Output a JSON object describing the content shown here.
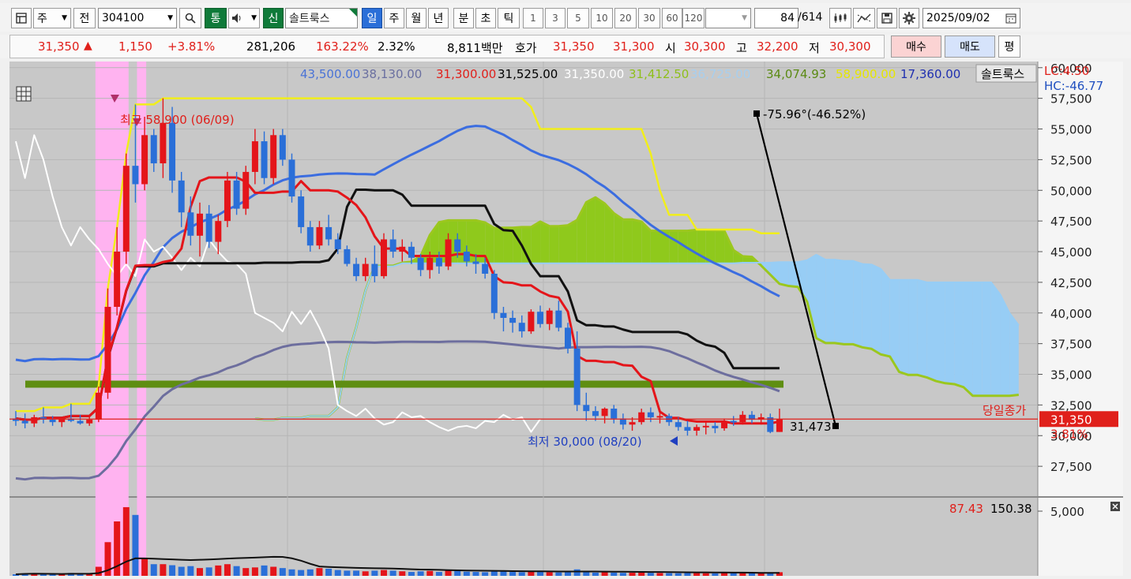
{
  "toolbar": {
    "mode": "주",
    "jeon": "전",
    "code": "304100",
    "tong": "통",
    "sin": "신",
    "stock_name": "솔트룩스",
    "periods": [
      "일",
      "주",
      "월",
      "년",
      "분",
      "초",
      "틱"
    ],
    "intervals": [
      "1",
      "3",
      "5",
      "10",
      "20",
      "30",
      "60",
      "120"
    ],
    "count": "84",
    "count_total": "/614",
    "date": "2025/09/02"
  },
  "quote": {
    "price": "31,350",
    "change": "1,150",
    "pct": "+3.81%",
    "volume": "281,206",
    "vol_ratio": "163.22%",
    "turnover": "2.32%",
    "amount": "8,811백만",
    "hoga_label": "호가",
    "ask": "31,350",
    "bid": "31,300",
    "open_label": "시",
    "open": "30,300",
    "high_label": "고",
    "high": "32,200",
    "low_label": "저",
    "low": "30,300",
    "buy": "매수",
    "sell": "매도",
    "eval": "평"
  },
  "legend": {
    "v1": "43,500.00",
    "v2": "38,130.00",
    "v3": "31,300.00",
    "v4": "31,525.00",
    "v5": "31,350.00",
    "v6": "31,412.50",
    "v7": "36,725.00",
    "v8": "34,074.93",
    "v9": "58,900.00",
    "v10": "17,360.00",
    "name": "솔트룩스",
    "lc": "LC:4.50",
    "hc": "HC:-46.77"
  },
  "annotations": {
    "max": "최고 58,900 (06/09)",
    "min": "최저 30,000 (08/20)",
    "trend": "-75.96°(-46.52%)",
    "trend_end": "31,473",
    "close_label": "당일종가",
    "close_price": "31,350",
    "close_pct": "3.81%"
  },
  "volume_legend": {
    "v1": "87.43",
    "v2": "150.38"
  },
  "chart_data": {
    "type": "candlestick",
    "price_axis": {
      "ticks": [
        "60,000",
        "57,500",
        "55,000",
        "52,500",
        "50,000",
        "47,500",
        "45,000",
        "42,500",
        "40,000",
        "37,500",
        "35,000",
        "32,500",
        "30,000",
        "27,500"
      ],
      "range": [
        25000,
        60500
      ]
    },
    "volume_axis": {
      "ticks": [
        "5,000"
      ]
    },
    "candles": [
      [
        31400,
        32000,
        30800,
        31200
      ],
      [
        31200,
        31800,
        30600,
        31000
      ],
      [
        31000,
        31700,
        30700,
        31500
      ],
      [
        31500,
        32300,
        31000,
        31300
      ],
      [
        31300,
        31600,
        30800,
        31100
      ],
      [
        31100,
        31500,
        30700,
        31400
      ],
      [
        31400,
        32600,
        31100,
        31200
      ],
      [
        31200,
        31700,
        30900,
        31000
      ],
      [
        31000,
        31600,
        30800,
        31300
      ],
      [
        31300,
        34000,
        31100,
        33500
      ],
      [
        33500,
        42000,
        33000,
        40500
      ],
      [
        40500,
        47000,
        39800,
        45000
      ],
      [
        45000,
        53000,
        44000,
        52000
      ],
      [
        52000,
        57000,
        49000,
        50500
      ],
      [
        50500,
        56000,
        50000,
        54500
      ],
      [
        54500,
        55000,
        51500,
        52200
      ],
      [
        52200,
        57500,
        51000,
        55500
      ],
      [
        55500,
        56800,
        49800,
        50800
      ],
      [
        50800,
        51500,
        47000,
        48200
      ],
      [
        48200,
        49500,
        45500,
        46300
      ],
      [
        46300,
        49000,
        44600,
        48100
      ],
      [
        48100,
        48800,
        45300,
        45800
      ],
      [
        45800,
        48000,
        44800,
        47500
      ],
      [
        47500,
        51500,
        47000,
        50800
      ],
      [
        50800,
        51500,
        48000,
        48500
      ],
      [
        48500,
        52000,
        48000,
        51500
      ],
      [
        51500,
        55000,
        50500,
        54000
      ],
      [
        54000,
        54800,
        50500,
        51000
      ],
      [
        51000,
        55000,
        50500,
        54500
      ],
      [
        54500,
        55000,
        52000,
        52500
      ],
      [
        52500,
        53000,
        49000,
        49500
      ],
      [
        49500,
        50000,
        46500,
        47000
      ],
      [
        47000,
        47500,
        45000,
        45500
      ],
      [
        45500,
        47500,
        45200,
        47000
      ],
      [
        47000,
        48000,
        45500,
        46000
      ],
      [
        46000,
        46500,
        44800,
        45200
      ],
      [
        45200,
        45500,
        43800,
        44000
      ],
      [
        44000,
        44500,
        42600,
        43000
      ],
      [
        43000,
        44500,
        42600,
        44000
      ],
      [
        44000,
        45500,
        42500,
        43000
      ],
      [
        43000,
        46500,
        42800,
        46000
      ],
      [
        46000,
        46800,
        44500,
        45000
      ],
      [
        45000,
        46000,
        44200,
        45400
      ],
      [
        45400,
        45800,
        44000,
        44500
      ],
      [
        44500,
        44800,
        43000,
        43500
      ],
      [
        43500,
        45000,
        42800,
        44500
      ],
      [
        44500,
        45000,
        43200,
        43800
      ],
      [
        43800,
        46500,
        43500,
        46000
      ],
      [
        46000,
        46500,
        44500,
        45000
      ],
      [
        45000,
        45500,
        43800,
        44200
      ],
      [
        44200,
        44800,
        43200,
        44000
      ],
      [
        44000,
        44500,
        42800,
        43200
      ],
      [
        43200,
        43500,
        39500,
        40000
      ],
      [
        40000,
        40500,
        38500,
        39600
      ],
      [
        39600,
        40200,
        38400,
        39200
      ],
      [
        39200,
        39800,
        38000,
        38500
      ],
      [
        38500,
        40300,
        38300,
        40100
      ],
      [
        40100,
        40600,
        38800,
        39100
      ],
      [
        39100,
        40400,
        38600,
        40200
      ],
      [
        40200,
        41000,
        38500,
        38800
      ],
      [
        38800,
        39200,
        36700,
        37100
      ],
      [
        37100,
        38500,
        32000,
        32500
      ],
      [
        32500,
        33500,
        31200,
        32000
      ],
      [
        32000,
        32400,
        31200,
        31600
      ],
      [
        31600,
        32300,
        31000,
        32200
      ],
      [
        32200,
        32500,
        31000,
        31400
      ],
      [
        31400,
        31800,
        30500,
        30900
      ],
      [
        30900,
        31500,
        30400,
        31100
      ],
      [
        31100,
        32200,
        30900,
        31900
      ],
      [
        31900,
        32300,
        31100,
        31500
      ],
      [
        31500,
        32000,
        31000,
        31600
      ],
      [
        31600,
        31800,
        30800,
        31100
      ],
      [
        31100,
        31500,
        30400,
        30700
      ],
      [
        30700,
        31200,
        30000,
        30400
      ],
      [
        30400,
        30900,
        30000,
        30700
      ],
      [
        30700,
        31200,
        30100,
        30800
      ],
      [
        30800,
        31100,
        30200,
        30600
      ],
      [
        30600,
        31400,
        30400,
        31200
      ],
      [
        31200,
        31600,
        30800,
        31100
      ],
      [
        31100,
        32000,
        30900,
        31700
      ],
      [
        31700,
        32000,
        31000,
        31300
      ],
      [
        31300,
        31800,
        30900,
        31500
      ],
      [
        31500,
        31800,
        30200,
        30300
      ],
      [
        30300,
        32200,
        30300,
        31350
      ]
    ],
    "volumes": [
      120,
      180,
      200,
      150,
      100,
      140,
      220,
      160,
      180,
      700,
      2600,
      4200,
      5300,
      4700,
      1300,
      900,
      900,
      820,
      700,
      750,
      600,
      650,
      800,
      900,
      750,
      600,
      650,
      800,
      700,
      600,
      500,
      450,
      500,
      600,
      550,
      450,
      400,
      400,
      350,
      400,
      450,
      400,
      350,
      300,
      350,
      380,
      300,
      420,
      380,
      320,
      300,
      280,
      420,
      350,
      300,
      280,
      320,
      300,
      280,
      260,
      350,
      500,
      300,
      250,
      280,
      250,
      230,
      240,
      260,
      230,
      220,
      210,
      200,
      220,
      210,
      200,
      190,
      220,
      210,
      230,
      200,
      210,
      250,
      281
    ]
  }
}
